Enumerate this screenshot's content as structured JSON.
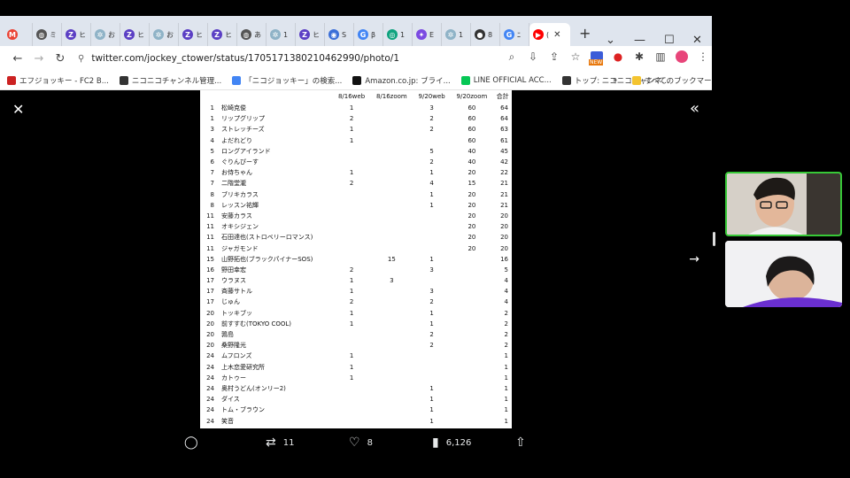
{
  "browser": {
    "tabs": [
      {
        "icon": "gmail-icon",
        "color": "#ea4335",
        "glyph": "M",
        "text": ""
      },
      {
        "icon": "globe-icon",
        "color": "#555555",
        "glyph": "◍",
        "text": "ミ"
      },
      {
        "icon": "z-icon",
        "color": "#5b3fc4",
        "glyph": "Z",
        "text": "ヒ"
      },
      {
        "icon": "loading-icon",
        "color": "#8fb3c7",
        "glyph": "✲",
        "text": "お"
      },
      {
        "icon": "z-icon",
        "color": "#5b3fc4",
        "glyph": "Z",
        "text": "ヒ"
      },
      {
        "icon": "loading-icon",
        "color": "#8fb3c7",
        "glyph": "✲",
        "text": "お"
      },
      {
        "icon": "z-icon",
        "color": "#5b3fc4",
        "glyph": "Z",
        "text": "ヒ"
      },
      {
        "icon": "z-icon",
        "color": "#5b3fc4",
        "glyph": "Z",
        "text": "ヒ"
      },
      {
        "icon": "globe-icon",
        "color": "#555555",
        "glyph": "◍",
        "text": "あ"
      },
      {
        "icon": "loading-icon",
        "color": "#8fb3c7",
        "glyph": "✲",
        "text": "1"
      },
      {
        "icon": "z-icon",
        "color": "#5b3fc4",
        "glyph": "Z",
        "text": "ヒ"
      },
      {
        "icon": "signal-icon",
        "color": "#3b6fd8",
        "glyph": "◉",
        "text": "S"
      },
      {
        "icon": "google-icon",
        "color": "#4285f4",
        "glyph": "G",
        "text": "β"
      },
      {
        "icon": "chatgpt-icon",
        "color": "#10a37f",
        "glyph": "◎",
        "text": "1"
      },
      {
        "icon": "gemini-icon",
        "color": "#7b4ae2",
        "glyph": "✦",
        "text": "E"
      },
      {
        "icon": "loading-icon",
        "color": "#8fb3c7",
        "glyph": "✲",
        "text": "1"
      },
      {
        "icon": "github-icon",
        "color": "#333333",
        "glyph": "●",
        "text": "8"
      },
      {
        "icon": "google-icon",
        "color": "#4285f4",
        "glyph": "G",
        "text": "ﾆ"
      },
      {
        "icon": "youtube-icon",
        "color": "#ff0000",
        "glyph": "▶",
        "text": "("
      }
    ],
    "new_tab": "+",
    "url": "twitter.com/jockey_ctower/status/1705171380210462990/photo/1",
    "bookmarks": [
      {
        "icon": "fc2-icon",
        "color": "#cc2222",
        "label": "エフジョッキー - FC2 B..."
      },
      {
        "icon": "niconico-icon",
        "color": "#333333",
        "label": "ニコニコチャンネル管理..."
      },
      {
        "icon": "google-icon",
        "color": "#4285f4",
        "label": "「ニコジョッキー」の検索..."
      },
      {
        "icon": "amazon-icon",
        "color": "#111111",
        "label": "Amazon.co.jp: ブライ..."
      },
      {
        "icon": "line-icon",
        "color": "#06c755",
        "label": "LINE OFFICIAL ACC..."
      },
      {
        "icon": "niconico-icon",
        "color": "#333333",
        "label": "トップ: ニコニコチャンネ..."
      }
    ],
    "bookmarks_more": "»",
    "all_bookmarks": "すべてのブックマーク",
    "new_badge": "NEW"
  },
  "table": {
    "headers": [
      "",
      "",
      "8/16web",
      "8/16zoom",
      "9/20web",
      "9/20zoom",
      "合計"
    ],
    "rows": [
      [
        "1",
        "松崎克俊",
        "1",
        "",
        "3",
        "60",
        "64"
      ],
      [
        "1",
        "リップグリップ",
        "2",
        "",
        "2",
        "60",
        "64"
      ],
      [
        "3",
        "ストレッチーズ",
        "1",
        "",
        "2",
        "60",
        "63"
      ],
      [
        "4",
        "よだれどり",
        "1",
        "",
        "",
        "60",
        "61"
      ],
      [
        "5",
        "ロングアイランド",
        "",
        "",
        "5",
        "40",
        "45"
      ],
      [
        "6",
        "ぐりんぴーす",
        "",
        "",
        "2",
        "40",
        "42"
      ],
      [
        "7",
        "お侍ちゃん",
        "1",
        "",
        "1",
        "20",
        "22"
      ],
      [
        "7",
        "二階堂瀧",
        "2",
        "",
        "4",
        "15",
        "21"
      ],
      [
        "8",
        "ブリキカラス",
        "",
        "",
        "1",
        "20",
        "21"
      ],
      [
        "8",
        "レッスン祐輝",
        "",
        "",
        "1",
        "20",
        "21"
      ],
      [
        "11",
        "安藤カラス",
        "",
        "",
        "",
        "20",
        "20"
      ],
      [
        "11",
        "オキシジェン",
        "",
        "",
        "",
        "20",
        "20"
      ],
      [
        "11",
        "石田達也(ストロベリーロマンス)",
        "",
        "",
        "",
        "20",
        "20"
      ],
      [
        "11",
        "ジャガモンド",
        "",
        "",
        "",
        "20",
        "20"
      ],
      [
        "15",
        "山野拓也(ブラックパイナーSOS)",
        "",
        "15",
        "1",
        "",
        "16"
      ],
      [
        "16",
        "野田幸宏",
        "2",
        "",
        "3",
        "",
        "5"
      ],
      [
        "17",
        "ウラヌス",
        "1",
        "3",
        "",
        "",
        "4"
      ],
      [
        "17",
        "斉藤サトル",
        "1",
        "",
        "3",
        "",
        "4"
      ],
      [
        "17",
        "じゅん",
        "2",
        "",
        "2",
        "",
        "4"
      ],
      [
        "20",
        "トッキブッ",
        "1",
        "",
        "1",
        "",
        "2"
      ],
      [
        "20",
        "前すすむ(TOKYO COOL)",
        "1",
        "",
        "1",
        "",
        "2"
      ],
      [
        "20",
        "鶉島",
        "",
        "",
        "2",
        "",
        "2"
      ],
      [
        "20",
        "桑野隆光",
        "",
        "",
        "2",
        "",
        "2"
      ],
      [
        "24",
        "ムフロンズ",
        "1",
        "",
        "",
        "",
        "1"
      ],
      [
        "24",
        "上木恋愛研究所",
        "1",
        "",
        "",
        "",
        "1"
      ],
      [
        "24",
        "カトゥー",
        "1",
        "",
        "",
        "",
        "1"
      ],
      [
        "24",
        "奥村うどん(オンリー2)",
        "",
        "",
        "1",
        "",
        "1"
      ],
      [
        "24",
        "ダイス",
        "",
        "",
        "1",
        "",
        "1"
      ],
      [
        "24",
        "トム・ブラウン",
        "",
        "",
        "1",
        "",
        "1"
      ],
      [
        "24",
        "笑音",
        "",
        "",
        "1",
        "",
        "1"
      ]
    ]
  },
  "actions": {
    "retweets": "11",
    "likes": "8",
    "views": "6,126"
  }
}
